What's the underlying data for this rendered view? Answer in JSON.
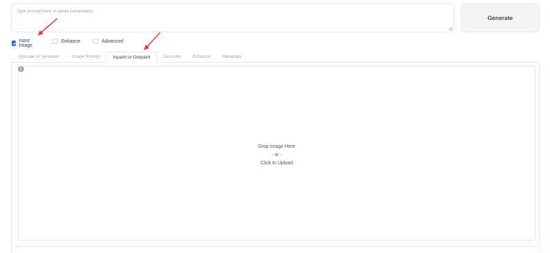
{
  "prompt": {
    "placeholder": "Type prompt here or paste parameters."
  },
  "generate_button": {
    "label": "Generate"
  },
  "options": [
    {
      "label": "Input Image",
      "checked": true
    },
    {
      "label": "Enhance",
      "checked": false
    },
    {
      "label": "Advanced",
      "checked": false
    }
  ],
  "tabs": [
    {
      "label": "Upscale or Variation",
      "active": false
    },
    {
      "label": "Image Prompt",
      "active": false
    },
    {
      "label": "Inpaint or Outpaint",
      "active": true
    },
    {
      "label": "Describe",
      "active": false
    },
    {
      "label": "Enhance",
      "active": false
    },
    {
      "label": "Metadata",
      "active": false
    }
  ],
  "upload": {
    "line1": "Drop Image Here",
    "line2": "- or -",
    "line3": "Click to Upload"
  },
  "colors": {
    "accent": "#2563eb",
    "annotation_arrow": "#e53935"
  },
  "icons": [
    "info-icon",
    "checkbox-checked-icon",
    "resize-handle-icon",
    "annotation-arrow-icon"
  ]
}
